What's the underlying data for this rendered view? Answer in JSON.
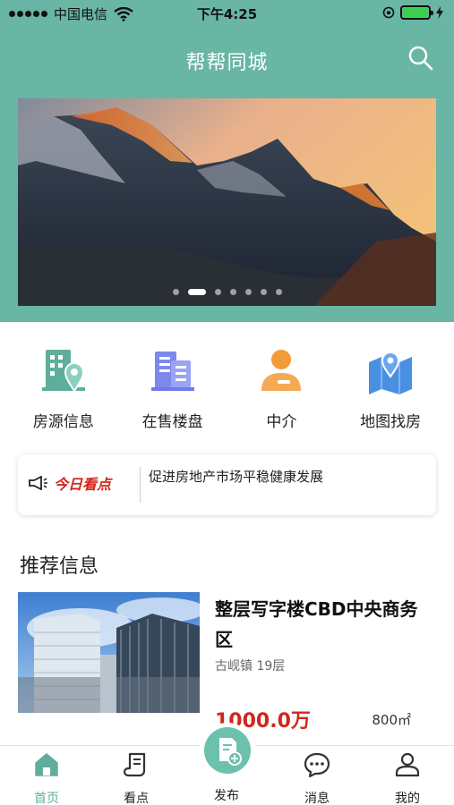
{
  "status_bar": {
    "carrier": "中国电信",
    "time": "下午4:25"
  },
  "header": {
    "title": "帮帮同城"
  },
  "banner": {
    "slide_count": 7,
    "active_index": 1
  },
  "quick_nav": [
    {
      "label": "房源信息",
      "icon": "building-location-icon",
      "color": "#5fae9b"
    },
    {
      "label": "在售楼盘",
      "icon": "buildings-icon",
      "color": "#6f7ce8"
    },
    {
      "label": "中介",
      "icon": "agent-person-icon",
      "color": "#f29b3b"
    },
    {
      "label": "地图找房",
      "icon": "map-pin-icon",
      "color": "#4a90e2"
    }
  ],
  "news": {
    "badge": "今日看点",
    "headline": "促进房地产市场平稳健康发展"
  },
  "recommend": {
    "title": "推荐信息",
    "items": [
      {
        "title": "整层写字楼CBD中央商务区",
        "subtitle": "古岘镇 19层",
        "price": "1000.0万",
        "area": "800㎡"
      }
    ]
  },
  "tab_bar": {
    "active_color": "#5fae9b",
    "tabs": [
      {
        "label": "首页",
        "icon": "home-icon"
      },
      {
        "label": "看点",
        "icon": "scroll-icon"
      },
      {
        "label": "发布",
        "icon": "publish-doc-icon"
      },
      {
        "label": "消息",
        "icon": "chat-bubble-icon"
      },
      {
        "label": "我的",
        "icon": "user-icon"
      }
    ]
  }
}
